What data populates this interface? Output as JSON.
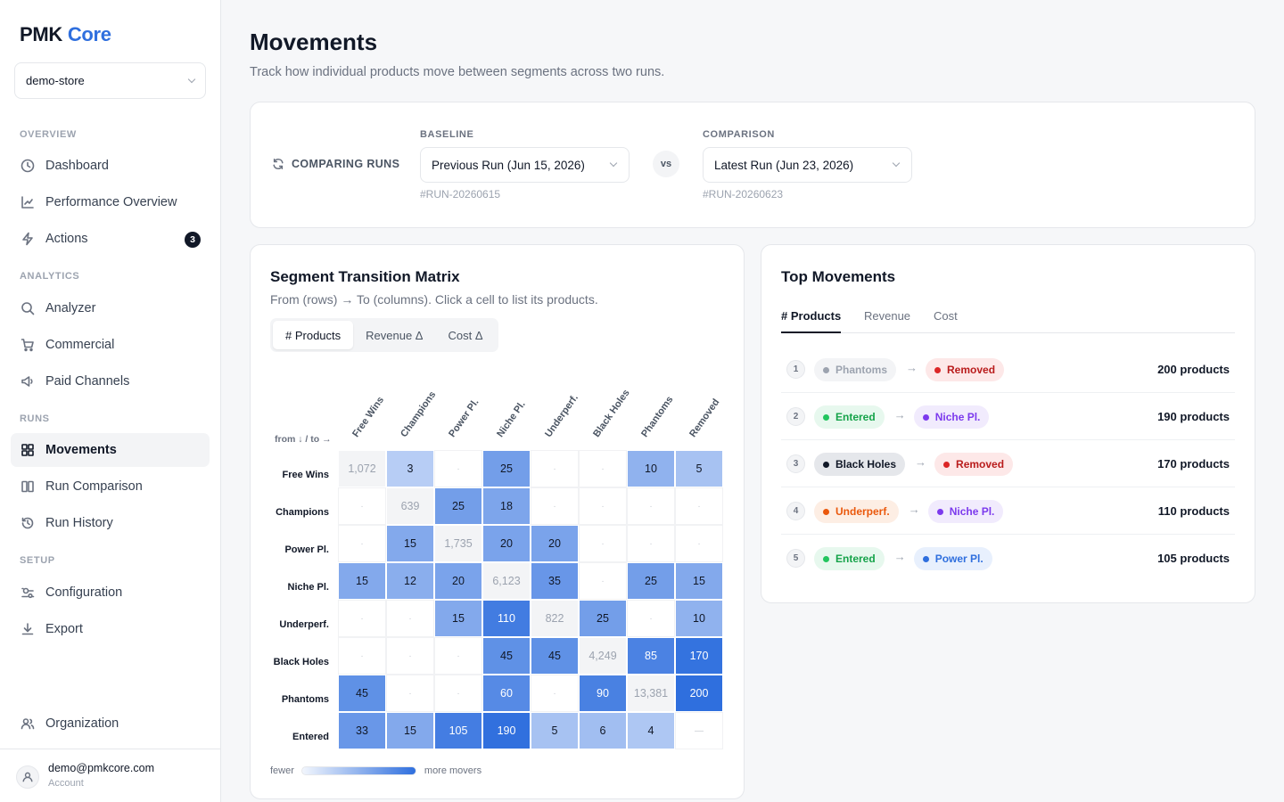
{
  "brand": {
    "name": "PMK",
    "accent": "Core"
  },
  "store_selector": {
    "value": "demo-store"
  },
  "sidebar": {
    "sections": {
      "overview": "OVERVIEW",
      "analytics": "ANALYTICS",
      "runs": "RUNS",
      "setup": "SETUP"
    },
    "items": [
      {
        "label": "Dashboard",
        "icon": "clock-icon"
      },
      {
        "label": "Performance Overview",
        "icon": "line-chart-icon"
      },
      {
        "label": "Actions",
        "icon": "lightning-icon",
        "badge": "3"
      },
      {
        "label": "Analyzer",
        "icon": "search-icon"
      },
      {
        "label": "Commercial",
        "icon": "cart-icon"
      },
      {
        "label": "Paid Channels",
        "icon": "megaphone-icon"
      },
      {
        "label": "Movements",
        "icon": "grid-icon",
        "active": true
      },
      {
        "label": "Run Comparison",
        "icon": "columns-icon"
      },
      {
        "label": "Run History",
        "icon": "history-icon"
      },
      {
        "label": "Configuration",
        "icon": "settings-icon"
      },
      {
        "label": "Export",
        "icon": "download-icon"
      },
      {
        "label": "Organization",
        "icon": "users-icon"
      }
    ],
    "account": {
      "email": "demo@pmkcore.com",
      "role": "Account"
    }
  },
  "header": {
    "title": "Movements",
    "subtitle": "Track how individual products move between segments across two runs."
  },
  "compare": {
    "label": "COMPARING RUNS",
    "baseline_label": "BASELINE",
    "baseline_value": "Previous Run (Jun 15, 2026)",
    "baseline_id": "#RUN-20260615",
    "vs": "vs",
    "comparison_label": "COMPARISON",
    "comparison_value": "Latest Run (Jun 23, 2026)",
    "comparison_id": "#RUN-20260623"
  },
  "matrix": {
    "title": "Segment Transition Matrix",
    "subtitle": "From (rows) → To (columns). Click a cell to list its products.",
    "tabs": [
      "# Products",
      "Revenue Δ",
      "Cost Δ"
    ],
    "active_tab": 0,
    "corner_label": "from ↓ / to →",
    "columns": [
      "Free Wins",
      "Champions",
      "Power Pl.",
      "Niche Pl.",
      "Underperf.",
      "Black Holes",
      "Phantoms",
      "Removed"
    ],
    "rows": [
      "Free Wins",
      "Champions",
      "Power Pl.",
      "Niche Pl.",
      "Underperf.",
      "Black Holes",
      "Phantoms",
      "Entered"
    ],
    "cells": [
      [
        "1,072",
        "3",
        "·",
        "25",
        "·",
        "·",
        "10",
        "5"
      ],
      [
        "·",
        "639",
        "25",
        "18",
        "·",
        "·",
        "·",
        "·"
      ],
      [
        "·",
        "15",
        "1,735",
        "20",
        "20",
        "·",
        "·",
        "·"
      ],
      [
        "15",
        "12",
        "20",
        "6,123",
        "35",
        "·",
        "25",
        "15"
      ],
      [
        "·",
        "·",
        "15",
        "110",
        "822",
        "25",
        "·",
        "10"
      ],
      [
        "·",
        "·",
        "·",
        "45",
        "45",
        "4,249",
        "85",
        "170"
      ],
      [
        "45",
        "·",
        "·",
        "60",
        "·",
        "90",
        "13,381",
        "200"
      ],
      [
        "33",
        "15",
        "105",
        "190",
        "5",
        "6",
        "4",
        "—"
      ]
    ],
    "legend_low": "fewer",
    "legend_high": "more movers"
  },
  "top_movements": {
    "title": "Top Movements",
    "tabs": [
      "# Products",
      "Revenue",
      "Cost"
    ],
    "active_tab": 0,
    "rows": [
      {
        "rank": "1",
        "from": "Phantoms",
        "from_color": "#9ca3af",
        "from_bg": "#f3f4f6",
        "from_text": "#9ca3af",
        "to": "Removed",
        "to_color": "#dc2626",
        "to_bg": "#fde8e8",
        "to_text": "#b91c1c",
        "count": "200 products"
      },
      {
        "rank": "2",
        "from": "Entered",
        "from_color": "#22c55e",
        "from_bg": "#e7f8ee",
        "from_text": "#16a34a",
        "to": "Niche Pl.",
        "to_color": "#7c3aed",
        "to_bg": "#f1ebfd",
        "to_text": "#7c3aed",
        "count": "190 products"
      },
      {
        "rank": "3",
        "from": "Black Holes",
        "from_color": "#111827",
        "from_bg": "#e5e7eb",
        "from_text": "#111827",
        "to": "Removed",
        "to_color": "#dc2626",
        "to_bg": "#fde8e8",
        "to_text": "#b91c1c",
        "count": "170 products"
      },
      {
        "rank": "4",
        "from": "Underperf.",
        "from_color": "#ea580c",
        "from_bg": "#fdeee4",
        "from_text": "#ea580c",
        "to": "Niche Pl.",
        "to_color": "#7c3aed",
        "to_bg": "#f1ebfd",
        "to_text": "#7c3aed",
        "count": "110 products"
      },
      {
        "rank": "5",
        "from": "Entered",
        "from_color": "#22c55e",
        "from_bg": "#e7f8ee",
        "from_text": "#16a34a",
        "to": "Power Pl.",
        "to_color": "#2f6fde",
        "to_bg": "#e8f0fd",
        "to_text": "#2f6fde",
        "count": "105 products"
      }
    ]
  },
  "colors": {
    "accent": "#2f6fde",
    "heat_low": "#dbe6fb",
    "heat_high": "#2f6fde",
    "diagonal": "#f3f4f6"
  }
}
